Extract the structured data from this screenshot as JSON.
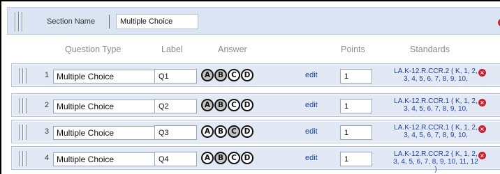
{
  "section": {
    "name_label": "Section Name",
    "name_value": "Multiple Choice"
  },
  "columns": {
    "question_type": "Question Type",
    "label": "Label",
    "answer": "Answer",
    "points": "Points",
    "standards": "Standards"
  },
  "icons": {
    "remove": "×",
    "remove_color": "#c8202e",
    "drag_handle": "drag-handle-icon"
  },
  "questions": [
    {
      "number": "1",
      "type": "Multiple Choice",
      "label": "Q1",
      "answers": [
        "A",
        "B",
        "C",
        "D"
      ],
      "selected": [
        "A",
        "B"
      ],
      "edit": "edit",
      "points": "1",
      "standards": "LA.K-12.R.CCR.2 ( K, 1, 2, 3, 4, 5, 6, 7, 8, 9, 10,"
    },
    {
      "number": "2",
      "type": "Multiple Choice",
      "label": "Q2",
      "answers": [
        "A",
        "B",
        "C",
        "D"
      ],
      "selected": [
        "A",
        "B"
      ],
      "edit": "edit",
      "points": "1",
      "standards": "LA.K-12.R.CCR.1 ( K, 1, 2, 3, 4, 5, 6, 7, 8, 9, 10,"
    },
    {
      "number": "3",
      "type": "Multiple Choice",
      "label": "Q3",
      "answers": [
        "A",
        "B",
        "C",
        "D"
      ],
      "selected": [
        "C"
      ],
      "edit": "edit",
      "points": "1",
      "standards": "LA.K-12.R.CCR.1 ( K, 1, 2, 3, 4, 5, 6, 7, 8, 9, 10,"
    },
    {
      "number": "4",
      "type": "Multiple Choice",
      "label": "Q4",
      "answers": [
        "A",
        "B",
        "C",
        "D"
      ],
      "selected": [
        "B"
      ],
      "edit": "edit",
      "points": "1",
      "standards": "LA.K-12.R.CCR.2 ( K, 1, 2, 3, 4, 5, 6, 7, 8, 9, 10, 11, 12 )"
    }
  ]
}
